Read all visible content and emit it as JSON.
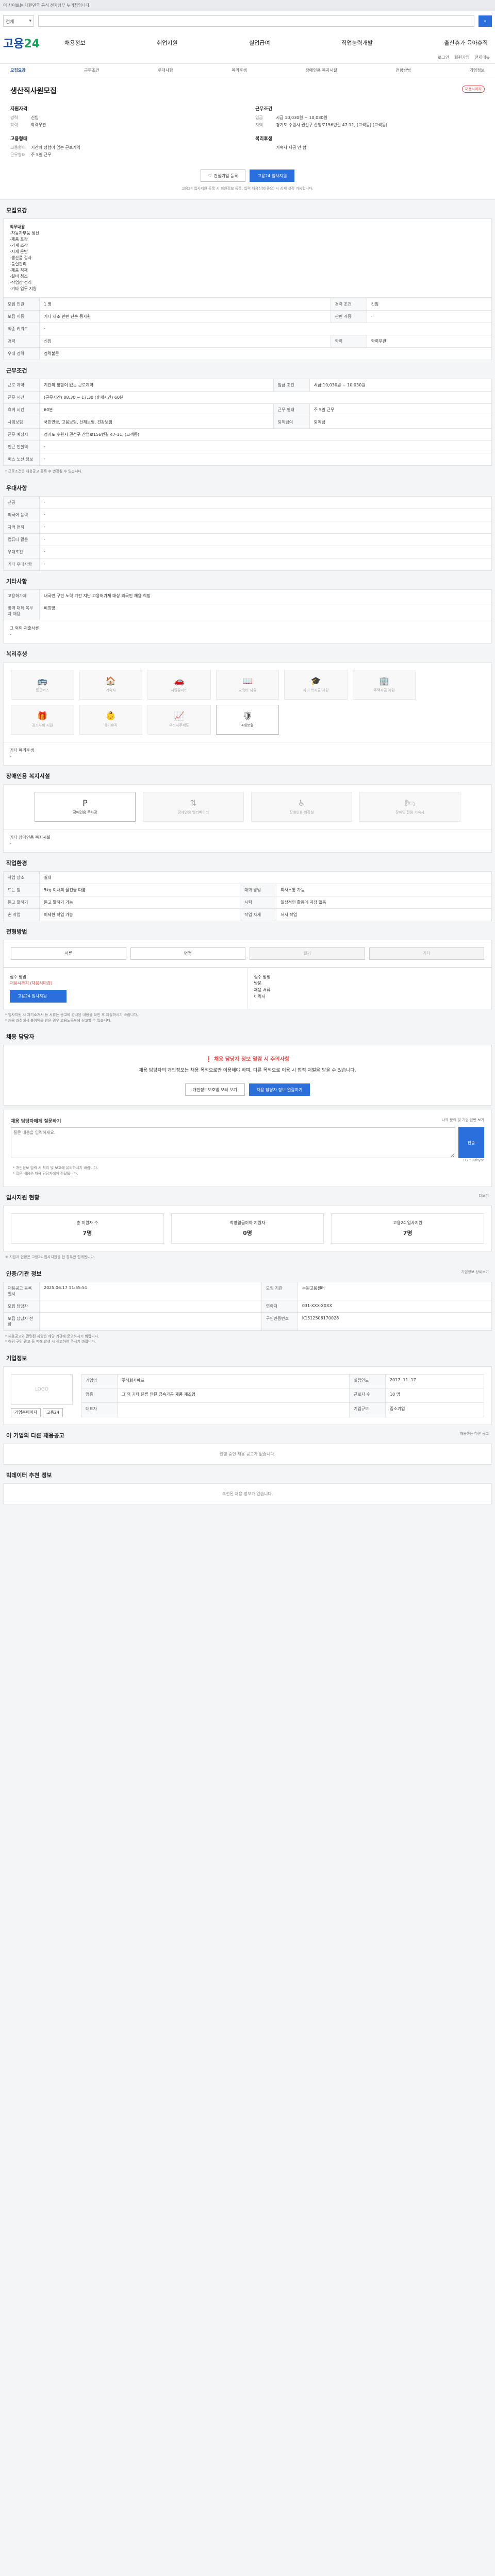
{
  "topbar": {
    "notice": "이 사이트는 대한민국 공식 전자정부 누리집입니다."
  },
  "search": {
    "select": "전체",
    "placeholder": "",
    "button": "검색"
  },
  "brand": {
    "logo_a": "고용",
    "logo_b": "24"
  },
  "gnb": [
    "채용정보",
    "취업지원",
    "실업급여",
    "직업능력개발",
    "출산휴가·육아휴직"
  ],
  "sublinks": [
    "로그인",
    "회원가입",
    "전체메뉴"
  ],
  "tabs": [
    "모집요강",
    "근무조건",
    "우대사항",
    "복리후생",
    "장애인용 복지시설",
    "전형방법",
    "기업정보"
  ],
  "job": {
    "title": "생산직사원모집",
    "badge": "채용시까지",
    "left_title": "지원자격",
    "left_rows": [
      [
        "경력",
        "신입"
      ],
      [
        "학력",
        "학력무관"
      ]
    ],
    "left_title2": "고용형태",
    "left_rows2": [
      [
        "고용형태",
        "기간의 정함이 없는 근로계약"
      ],
      [
        "근무형태",
        "주 5일 근무"
      ]
    ],
    "right_title": "근무조건",
    "right_rows": [
      [
        "임금",
        "시급 10,030원 ~ 10,030원"
      ],
      [
        "지역",
        "경기도 수원시 권선구 산업로156번길 47-11, (고색동) (고색동)"
      ]
    ],
    "right_title2": "복리후생",
    "right_rows2": [
      [
        "",
        "기숙사 제공 안 함"
      ]
    ],
    "btn_scrap": "관심기업 등록",
    "btn_apply": "고용24 입사지원",
    "note": "고용24 입사지원 등록 시 회원정보 등록, 입력 채용신청(중요) 시 상세 설정 가능합니다."
  },
  "recruit": {
    "section": "모집요강",
    "duty_title": "직무내용",
    "duty_lines": [
      "-자동차부품 생산",
      "-제품 포장",
      "-기계 조작",
      "-자재 운반",
      "-생산품 검사",
      "-품질관리",
      "-제품 적재",
      "-설비 청소",
      "-작업장 정리",
      "-기타 업무 지원"
    ],
    "rows": [
      [
        "모집 인원",
        "1 명",
        "경력 조건",
        "신입"
      ],
      [
        "모집 직종",
        "기타 제조 관련 단순 종사원",
        "관련 직종",
        "-"
      ],
      [
        "직종 키워드",
        "-",
        "",
        ""
      ],
      [
        "경력",
        "신입",
        "학력",
        "학력무관"
      ],
      [
        "우대 경력",
        "경력불문",
        "",
        ""
      ]
    ]
  },
  "conditions": {
    "section": "근무조건",
    "rows": [
      [
        "근로 계약",
        "기간의 정함이 없는 근로계약",
        "임금 조건",
        "시급 10,030원 ~ 10,030원"
      ],
      [
        "근무 시간",
        "(근무시간) 08:30 ~ 17:30 (휴게시간) 60분",
        "",
        ""
      ],
      [
        "휴게 시간",
        "60분",
        "근무 형태",
        "주 5일 근무"
      ],
      [
        "사회보험",
        "국민연금, 고용보험, 산재보험, 건강보험",
        "퇴직급여",
        "퇴직금"
      ],
      [
        "근무 예정지",
        "경기도 수원시 권선구 산업로156번길 47-11, (고색동)",
        "",
        ""
      ],
      [
        "인근 전철역",
        "-",
        "",
        ""
      ],
      [
        "버스 노선 정보",
        "-",
        "",
        ""
      ]
    ],
    "note": "* 근로조건은 채용공고 등록 후 변경될 수 있습니다."
  },
  "prefer": {
    "section": "우대사항",
    "rows": [
      [
        "전공",
        "-"
      ],
      [
        "외국어 능력",
        "-"
      ],
      [
        "자격 면허",
        "-"
      ],
      [
        "컴퓨터 활용",
        "-"
      ],
      [
        "우대조건",
        "-"
      ],
      [
        "기타 우대사항",
        "-"
      ]
    ]
  },
  "etc": {
    "section": "기타사항",
    "rows": [
      [
        "고용허가제",
        "내국인 구인 노력 기간 지난 고용허가제 대상 외국인 채용 희망"
      ],
      [
        "병역 대체 복무자 채용",
        "비희망"
      ]
    ],
    "doc_title": "그 외의 제출서류",
    "doc_value": "-"
  },
  "welfare": {
    "section": "복리후생",
    "items": [
      [
        "통근버스",
        false,
        "🚌"
      ],
      [
        "기숙사",
        false,
        "🏠"
      ],
      [
        "차량유지비",
        false,
        "🚗"
      ],
      [
        "교육비 지원",
        false,
        "📖"
      ],
      [
        "자녀 학자금 지원",
        false,
        "🎓"
      ],
      [
        "주택자금 지원",
        false,
        "🏢"
      ],
      [
        "",
        false,
        ""
      ],
      [
        "경조사비 지원",
        false,
        "🎁"
      ],
      [
        "육아휴직",
        false,
        "👶"
      ],
      [
        "우리사주제도",
        false,
        "📈"
      ],
      [
        "4대보험",
        true,
        "🛡"
      ]
    ],
    "other_title": "기타 복리후생",
    "other_value": "-"
  },
  "disabled": {
    "section": "장애인용 복지시설",
    "items": [
      [
        "장애인용 주차장",
        true,
        "P"
      ],
      [
        "장애인용 엘리베이터",
        false,
        "⇅"
      ],
      [
        "장애인용 화장실",
        false,
        "♿"
      ],
      [
        "장애인 전용 기숙사",
        false,
        "🛏"
      ]
    ],
    "other_title": "기타 장애인용 복지시설",
    "other_value": "-"
  },
  "workenv": {
    "section": "작업환경",
    "rows": [
      [
        "작업 장소",
        "실내",
        "",
        ""
      ],
      [
        "드는 힘",
        "5kg 이내의 물건을 다룸",
        "대화 방법",
        "의사소통 가능"
      ],
      [
        "듣고 말하기",
        "듣고 말하기 가능",
        "시력",
        "일상적인 활동에 지장 없음"
      ],
      [
        "손 작업",
        "미세한 작업 가능",
        "작업 자세",
        "서서 작업"
      ]
    ]
  },
  "process": {
    "section": "전형방법",
    "steps": [
      [
        "서류",
        true
      ],
      [
        "면접",
        true
      ],
      [
        "필기",
        false
      ],
      [
        "기타",
        false
      ]
    ],
    "apply_title": "접수 방법",
    "apply_value": "채용시까지 (채용시마감)",
    "apply_btn": "고용24 입사지원",
    "doc_title": "접수 방법",
    "doc_value": "방문",
    "doc_title2": "채용 서류",
    "doc_value2": "이력서",
    "notes": [
      "* 입사지원 시 자기소개서 등 서류는 공고에 명시된 내용을 확인 후 제출하시기 바랍니다.",
      "* 채용 과정에서 불이익을 받은 경우 고용노동부에 신고할 수 있습니다."
    ]
  },
  "manager": {
    "section": "채용 담당자",
    "warn_title": "❗ 채용 담당자 정보 열람 시 주의사항",
    "warn_text": "채용 담당자의 개인정보는 채용 목적으로만 이용해야 하며, 다른 목적으로 이용 시 법적 처벌을 받을 수 있습니다.",
    "btn_privacy": "개인정보보호법 보러 보기",
    "btn_view": "채용 담당자 정보 열람하기",
    "q_title": "채용 담당자에게 질문하기",
    "q_link": "나의 문의 및 기업 답변 보기",
    "q_placeholder": "질문 내용을 입력하세요.",
    "q_btn": "전송",
    "q_notes": [
      "* 개인정보 입력 시 처리 및 보호에 유의하시기 바랍니다.",
      "* 질문 내용은 채용 담당자에게 전달됩니다."
    ],
    "q_count": "0 / 500byte"
  },
  "status": {
    "section": "입사지원 현황",
    "more": "더보기",
    "stats": [
      [
        "총 지원자 수",
        "7명"
      ],
      [
        "희망월급이하 지원자",
        "0명"
      ],
      [
        "고용24 입사지원",
        "7명"
      ]
    ],
    "note": "※ 지원자 현황은 고용24 입사지원을 한 경우만 집계됩니다."
  },
  "agency": {
    "section": "인증/기관 정보",
    "btn": "기업정보 상세보기",
    "rows": [
      [
        "채용공고 등록일시",
        "2025.06.17 11:55:51",
        "모집 기관",
        "수원고용센터"
      ],
      [
        "모집 담당자",
        "",
        "연락처",
        "031-XXX-XXXX"
      ],
      [
        "모집 담당자 전화",
        "",
        "구인인증번호",
        "K1512506170028"
      ]
    ],
    "notes": [
      "* 채용공고와 관련된 사항은 해당 기관에 문의하시기 바랍니다.",
      "* 허위 구인 광고 등 피해 발생 시 신고하여 주시기 바랍니다."
    ]
  },
  "company": {
    "section": "기업정보",
    "logo": "LOGO",
    "rows": [
      [
        "기업명",
        "주식회사에프",
        "설립연도",
        "2017. 11. 17"
      ],
      [
        "업종",
        "그 외 기타 분류 안된 금속가공 제품 제조업",
        "근로자 수",
        "10 명"
      ],
      [
        "대표자",
        "",
        "기업규모",
        "중소기업"
      ]
    ],
    "btn1": "기업홈페이지",
    "btn2": "고용24"
  },
  "others": {
    "section": "이 기업의 다른 채용공고",
    "more": "채용하는 다른 공고",
    "empty": "진행 중인 채용 공고가 없습니다."
  },
  "recommend": {
    "section": "빅데이터 추천 정보",
    "empty": "추천된 채용 정보가 없습니다."
  }
}
